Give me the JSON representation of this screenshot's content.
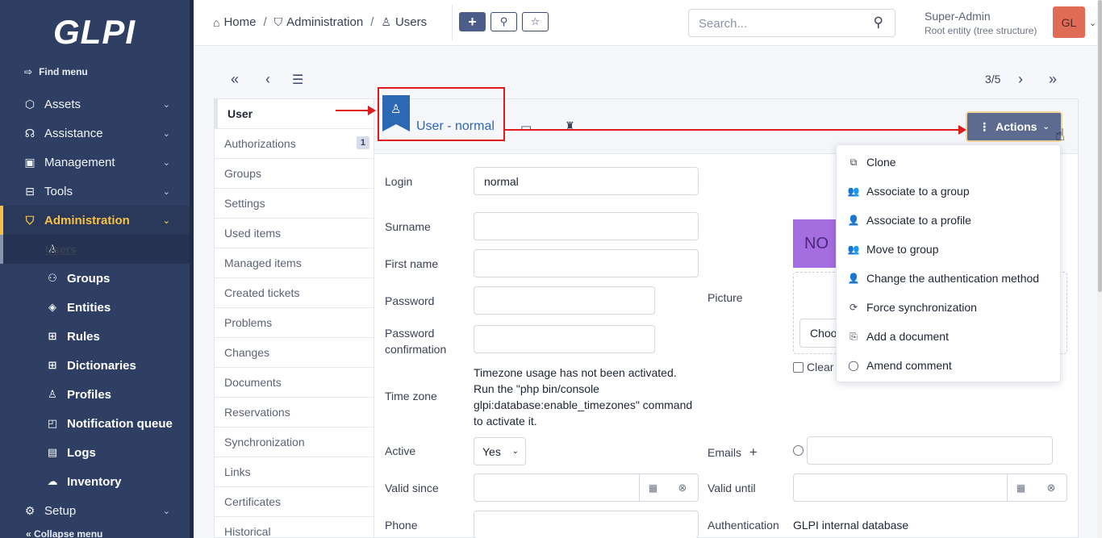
{
  "sidebar": {
    "logo": "GLPI",
    "find_menu": "Find menu",
    "items": [
      {
        "label": "Assets"
      },
      {
        "label": "Assistance"
      },
      {
        "label": "Management"
      },
      {
        "label": "Tools"
      },
      {
        "label": "Administration"
      },
      {
        "label": "Setup"
      }
    ],
    "sub_items": [
      {
        "label": "Users"
      },
      {
        "label": "Groups"
      },
      {
        "label": "Entities"
      },
      {
        "label": "Rules"
      },
      {
        "label": "Dictionaries"
      },
      {
        "label": "Profiles"
      },
      {
        "label": "Notification queue"
      },
      {
        "label": "Logs"
      },
      {
        "label": "Inventory"
      }
    ],
    "collapse": "Collapse menu"
  },
  "topbar": {
    "breadcrumb": [
      "Home",
      "Administration",
      "Users"
    ],
    "search_placeholder": "Search...",
    "user_name": "Super-Admin",
    "user_entity": "Root entity (tree structure)",
    "avatar_initials": "GL"
  },
  "pager": {
    "position": "3/5"
  },
  "tabs": [
    {
      "label": "User"
    },
    {
      "label": "Authorizations",
      "badge": "1"
    },
    {
      "label": "Groups"
    },
    {
      "label": "Settings"
    },
    {
      "label": "Used items"
    },
    {
      "label": "Managed items"
    },
    {
      "label": "Created tickets"
    },
    {
      "label": "Problems"
    },
    {
      "label": "Changes"
    },
    {
      "label": "Documents"
    },
    {
      "label": "Reservations"
    },
    {
      "label": "Synchronization"
    },
    {
      "label": "Links"
    },
    {
      "label": "Certificates"
    },
    {
      "label": "Historical"
    }
  ],
  "item": {
    "title": "User - normal",
    "actions_label": "Actions"
  },
  "form": {
    "login_label": "Login",
    "login_value": "normal",
    "surname_label": "Surname",
    "firstname_label": "First name",
    "password_label": "Password",
    "password_conf_label": "Password confirmation",
    "timezone_label": "Time zone",
    "timezone_note": "Timezone usage has not been activated. Run the \"php bin/console glpi:database:enable_timezones\" command to activate it.",
    "active_label": "Active",
    "active_value": "Yes",
    "valid_since_label": "Valid since",
    "valid_until_label": "Valid until",
    "phone_label": "Phone",
    "picture_label": "Picture",
    "picture_placeholder": "NO",
    "choose_label": "Choose",
    "clear_label": "Clear",
    "emails_label": "Emails",
    "auth_label": "Authentication",
    "auth_value": "GLPI internal database"
  },
  "actions_menu": [
    {
      "label": "Clone",
      "icon": "clone-icon"
    },
    {
      "label": "Associate to a group",
      "icon": "users-icon"
    },
    {
      "label": "Associate to a profile",
      "icon": "user-shield-icon"
    },
    {
      "label": "Move to group",
      "icon": "users-cog-icon"
    },
    {
      "label": "Change the authentication method",
      "icon": "user-cog-icon"
    },
    {
      "label": "Force synchronization",
      "icon": "sync-icon"
    },
    {
      "label": "Add a document",
      "icon": "document-icon"
    },
    {
      "label": "Amend comment",
      "icon": "comment-icon"
    }
  ],
  "colors": {
    "sidebar": "#2f3f64",
    "accent": "#f6c145",
    "primary": "#2d68b5",
    "annotation": "#e01b1b"
  }
}
